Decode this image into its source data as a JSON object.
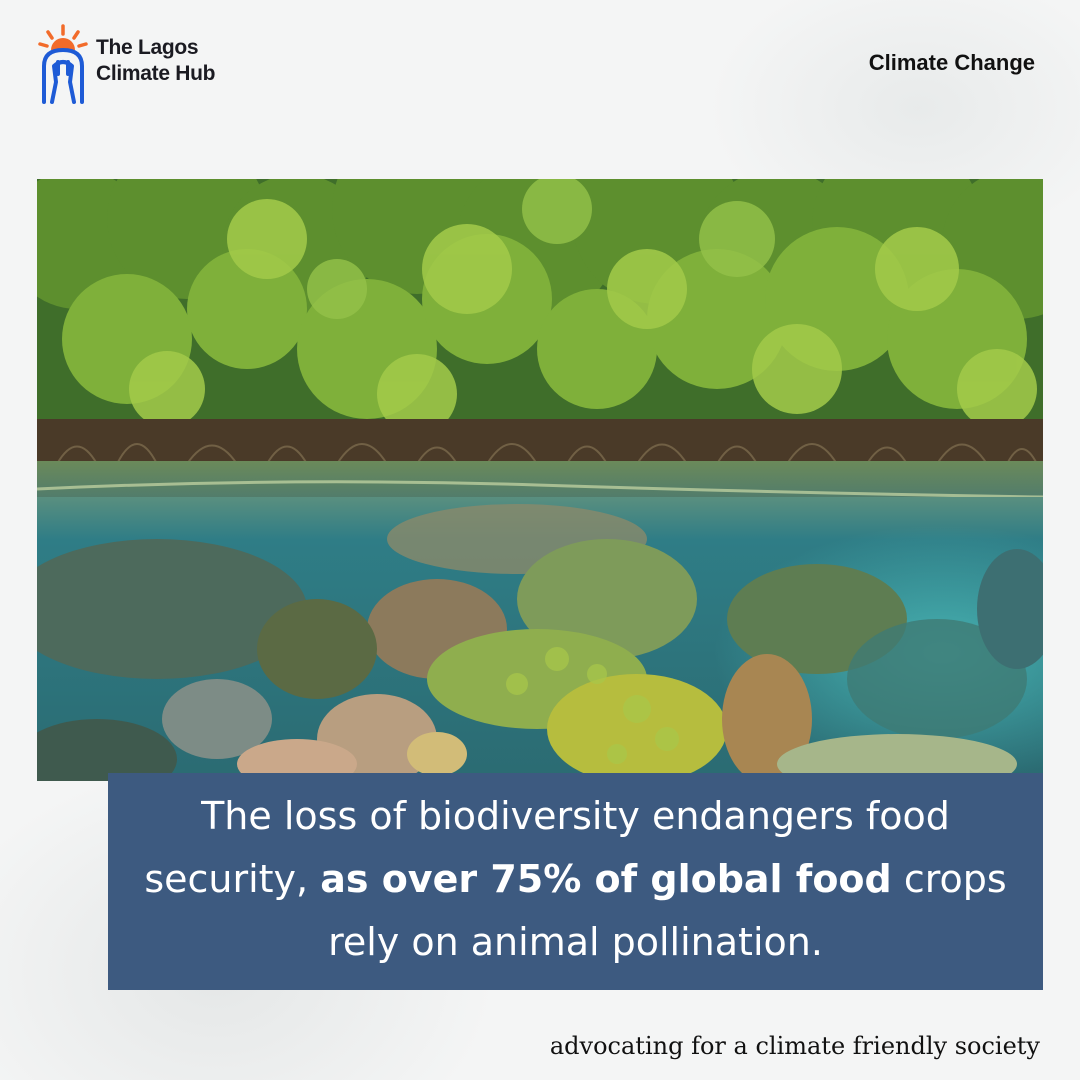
{
  "brand": {
    "name_line1": "The Lagos",
    "name_line2": "Climate Hub",
    "logo_icon": "sun-arch-figure-logo",
    "colors": {
      "sun": "#f26b2a",
      "arch": "#1e5bd6"
    }
  },
  "header": {
    "topic": "Climate Change"
  },
  "hero_image": {
    "subject": "mangrove-coral-reef-split-view"
  },
  "caption": {
    "text_before": "The loss of biodiversity endangers food security, ",
    "text_bold": "as over 75% of global food",
    "text_after": " crops rely on animal pollination.",
    "background": "#3d5a80"
  },
  "footer": {
    "tagline": "advocating for a climate friendly society"
  }
}
